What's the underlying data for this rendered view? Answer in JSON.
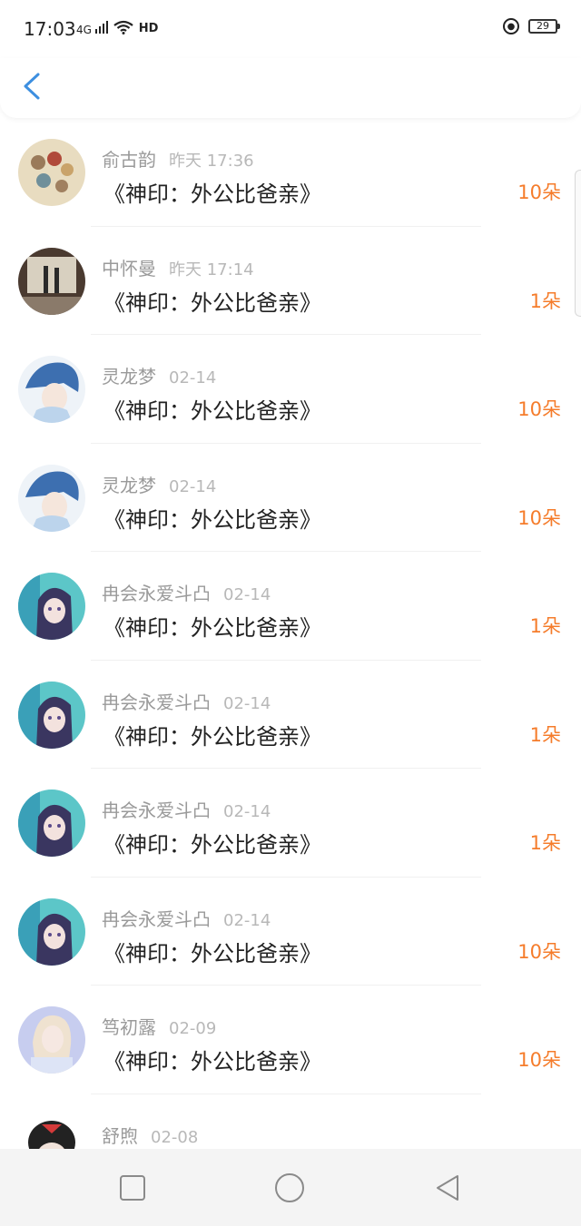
{
  "status": {
    "time": "17:03",
    "network": "4G",
    "wifi": "HD",
    "battery": "29"
  },
  "header": {
    "back_icon": "chevron-left-icon"
  },
  "colors": {
    "accent": "#3d8fe0",
    "count": "#f57c2b",
    "name": "#9a9a9a",
    "title": "#222222"
  },
  "rows": [
    {
      "name": "俞古韵",
      "time": "昨天 17:36",
      "title": "《神印：外公比爸亲》",
      "count": "10朵"
    },
    {
      "name": "中怀曼",
      "time": "昨天 17:14",
      "title": "《神印：外公比爸亲》",
      "count": "1朵"
    },
    {
      "name": "灵龙梦",
      "time": "02-14",
      "title": "《神印：外公比爸亲》",
      "count": "10朵"
    },
    {
      "name": "灵龙梦",
      "time": "02-14",
      "title": "《神印：外公比爸亲》",
      "count": "10朵"
    },
    {
      "name": "冉会永爱斗凸",
      "time": "02-14",
      "title": "《神印：外公比爸亲》",
      "count": "1朵"
    },
    {
      "name": "冉会永爱斗凸",
      "time": "02-14",
      "title": "《神印：外公比爸亲》",
      "count": "1朵"
    },
    {
      "name": "冉会永爱斗凸",
      "time": "02-14",
      "title": "《神印：外公比爸亲》",
      "count": "1朵"
    },
    {
      "name": "冉会永爱斗凸",
      "time": "02-14",
      "title": "《神印：外公比爸亲》",
      "count": "10朵"
    },
    {
      "name": "笃初露",
      "time": "02-09",
      "title": "《神印：外公比爸亲》",
      "count": "10朵"
    },
    {
      "name": "舒煦",
      "time": "02-08",
      "title": "",
      "count": ""
    }
  ],
  "nav": {
    "recent_icon": "square-icon",
    "home_icon": "circle-icon",
    "back_icon": "triangle-back-icon"
  }
}
